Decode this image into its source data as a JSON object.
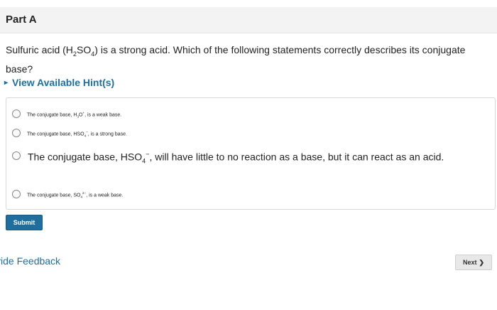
{
  "part": {
    "title": "Part A"
  },
  "question": {
    "pre": "Sulfuric acid (H",
    "sub1": "2",
    "mid": "SO",
    "sub2": "4",
    "post": ") is a strong acid. Which of the following statements correctly describes its conjugate base?"
  },
  "hint": {
    "label": "View Available Hint(s)"
  },
  "options": [
    {
      "pre": "The conjugate base, H",
      "sub": "3",
      "mid": "O",
      "sup": "+",
      "post": ", is a weak base."
    },
    {
      "pre": "The conjugate base, HSO",
      "sub": "4",
      "sup": "−",
      "post": ", is a strong base."
    },
    {
      "pre": "The conjugate base, HSO",
      "sub": "4",
      "sup": "−",
      "post": ", will have little to no reaction as a base, but it can react as an acid."
    },
    {
      "pre": "The conjugate base, SO",
      "sub": "4",
      "sup": "2−",
      "post": ", is a weak base."
    }
  ],
  "buttons": {
    "submit": "Submit",
    "next": "Next"
  },
  "feedback": {
    "label": "vide Feedback"
  }
}
